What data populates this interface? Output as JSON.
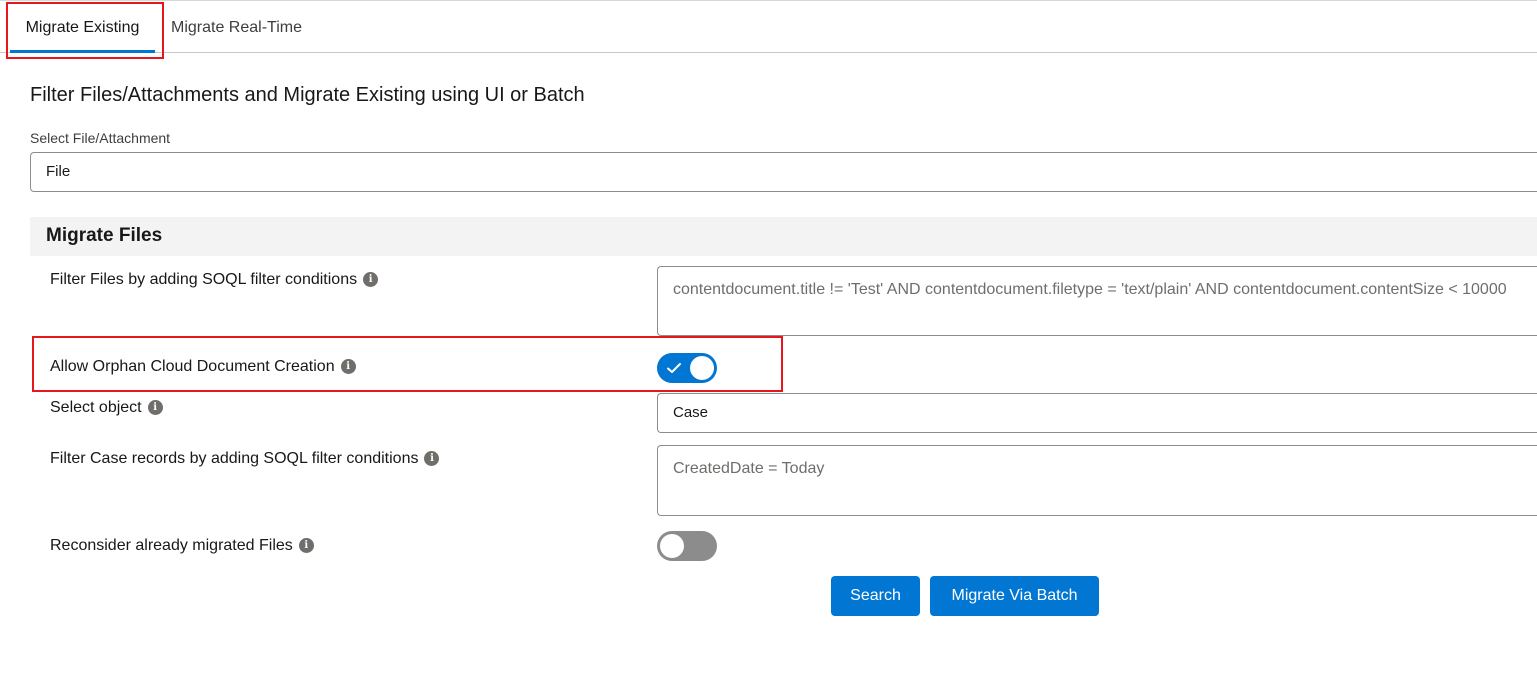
{
  "tabs": [
    {
      "label": "Migrate Existing",
      "active": true
    },
    {
      "label": "Migrate Real-Time",
      "active": false
    }
  ],
  "page_title": "Filter Files/Attachments and Migrate Existing using UI or Batch",
  "file_type_select": {
    "label": "Select File/Attachment",
    "value": "File"
  },
  "section": {
    "title": "Migrate Files"
  },
  "fields": {
    "file_filter": {
      "label": "Filter Files by adding SOQL filter conditions",
      "placeholder": "contentdocument.title != 'Test' AND contentdocument.filetype = 'text/plain' AND contentdocument.contentSize < 10000"
    },
    "orphan_toggle": {
      "label": "Allow Orphan Cloud Document Creation",
      "checked": true
    },
    "select_object": {
      "label": "Select object",
      "value": "Case"
    },
    "record_filter": {
      "label": "Filter Case records by adding SOQL filter conditions",
      "placeholder": "CreatedDate = Today"
    },
    "reconsider_toggle": {
      "label": "Reconsider already migrated Files",
      "checked": false
    }
  },
  "buttons": {
    "search": "Search",
    "migrate_batch": "Migrate Via Batch"
  },
  "icons": {
    "info": "info-icon",
    "check": "check-icon"
  },
  "colors": {
    "brand": "#0176d3",
    "highlight": "#e8151c",
    "toggle_off": "#8c8c8c",
    "section_bg": "#f3f3f3"
  }
}
